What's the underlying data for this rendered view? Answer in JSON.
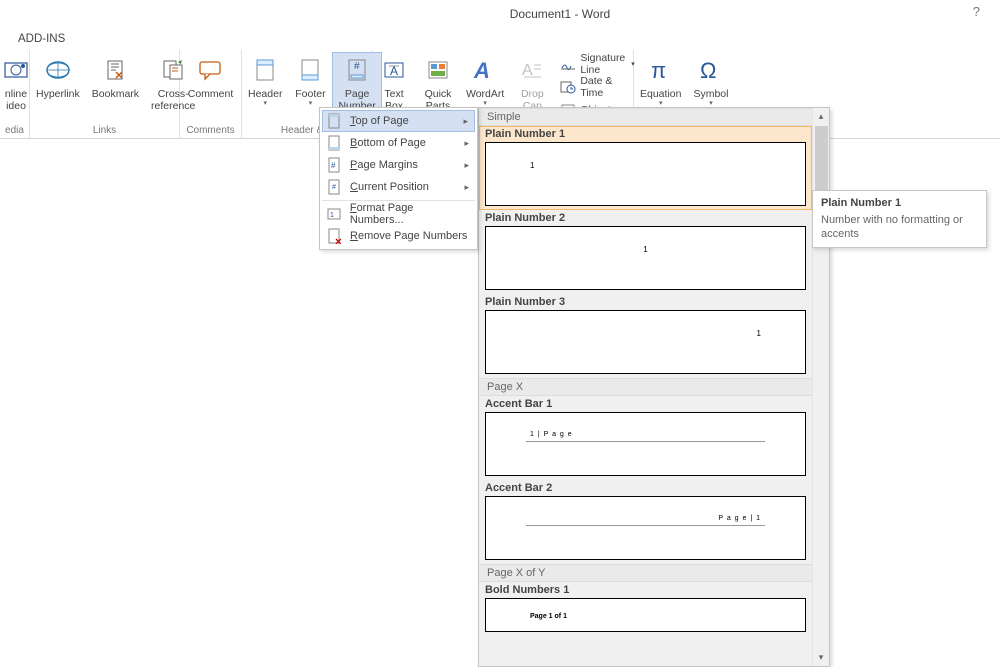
{
  "titlebar": {
    "title": "Document1 - Word",
    "help_icon": "?"
  },
  "tabrow": {
    "addins": "ADD-INS"
  },
  "ribbon": {
    "media": {
      "video": "nline\nideo",
      "group": "edia"
    },
    "links": {
      "hyperlink": "Hyperlink",
      "bookmark": "Bookmark",
      "crossref": "Cross-\nreference",
      "group": "Links"
    },
    "comments": {
      "comment": "Comment",
      "group": "Comments"
    },
    "headerfooter": {
      "header": "Header",
      "footer": "Footer",
      "pagenum": "Page\nNumber",
      "group": "Header & F"
    },
    "text": {
      "textbox": "Text\nBox",
      "quickparts": "Quick\nParts",
      "wordart": "WordArt",
      "dropcap": "Drop\nCap",
      "sigline": "Signature Line",
      "datetime": "Date & Time",
      "object": "Object"
    },
    "symbols": {
      "equation": "Equation",
      "symbol": "Symbol"
    }
  },
  "pagenum_menu": {
    "top": "Top of Page",
    "bottom": "Bottom of Page",
    "margins": "Page Margins",
    "current": "Current Position",
    "format": "Format Page Numbers...",
    "remove": "Remove Page Numbers"
  },
  "gallery": {
    "simple": "Simple",
    "plain1": "Plain Number 1",
    "plain2": "Plain Number 2",
    "plain3": "Plain Number 3",
    "pagex": "Page X",
    "accent1": "Accent Bar 1",
    "accent1_text": "1 | P a g e",
    "accent2": "Accent Bar 2",
    "accent2_text": "P a g e | 1",
    "pagexy": "Page X of Y",
    "bold1": "Bold Numbers 1",
    "bold1_text": "Page 1 of 1"
  },
  "tooltip": {
    "title": "Plain Number 1",
    "body": "Number with no formatting or accents"
  }
}
